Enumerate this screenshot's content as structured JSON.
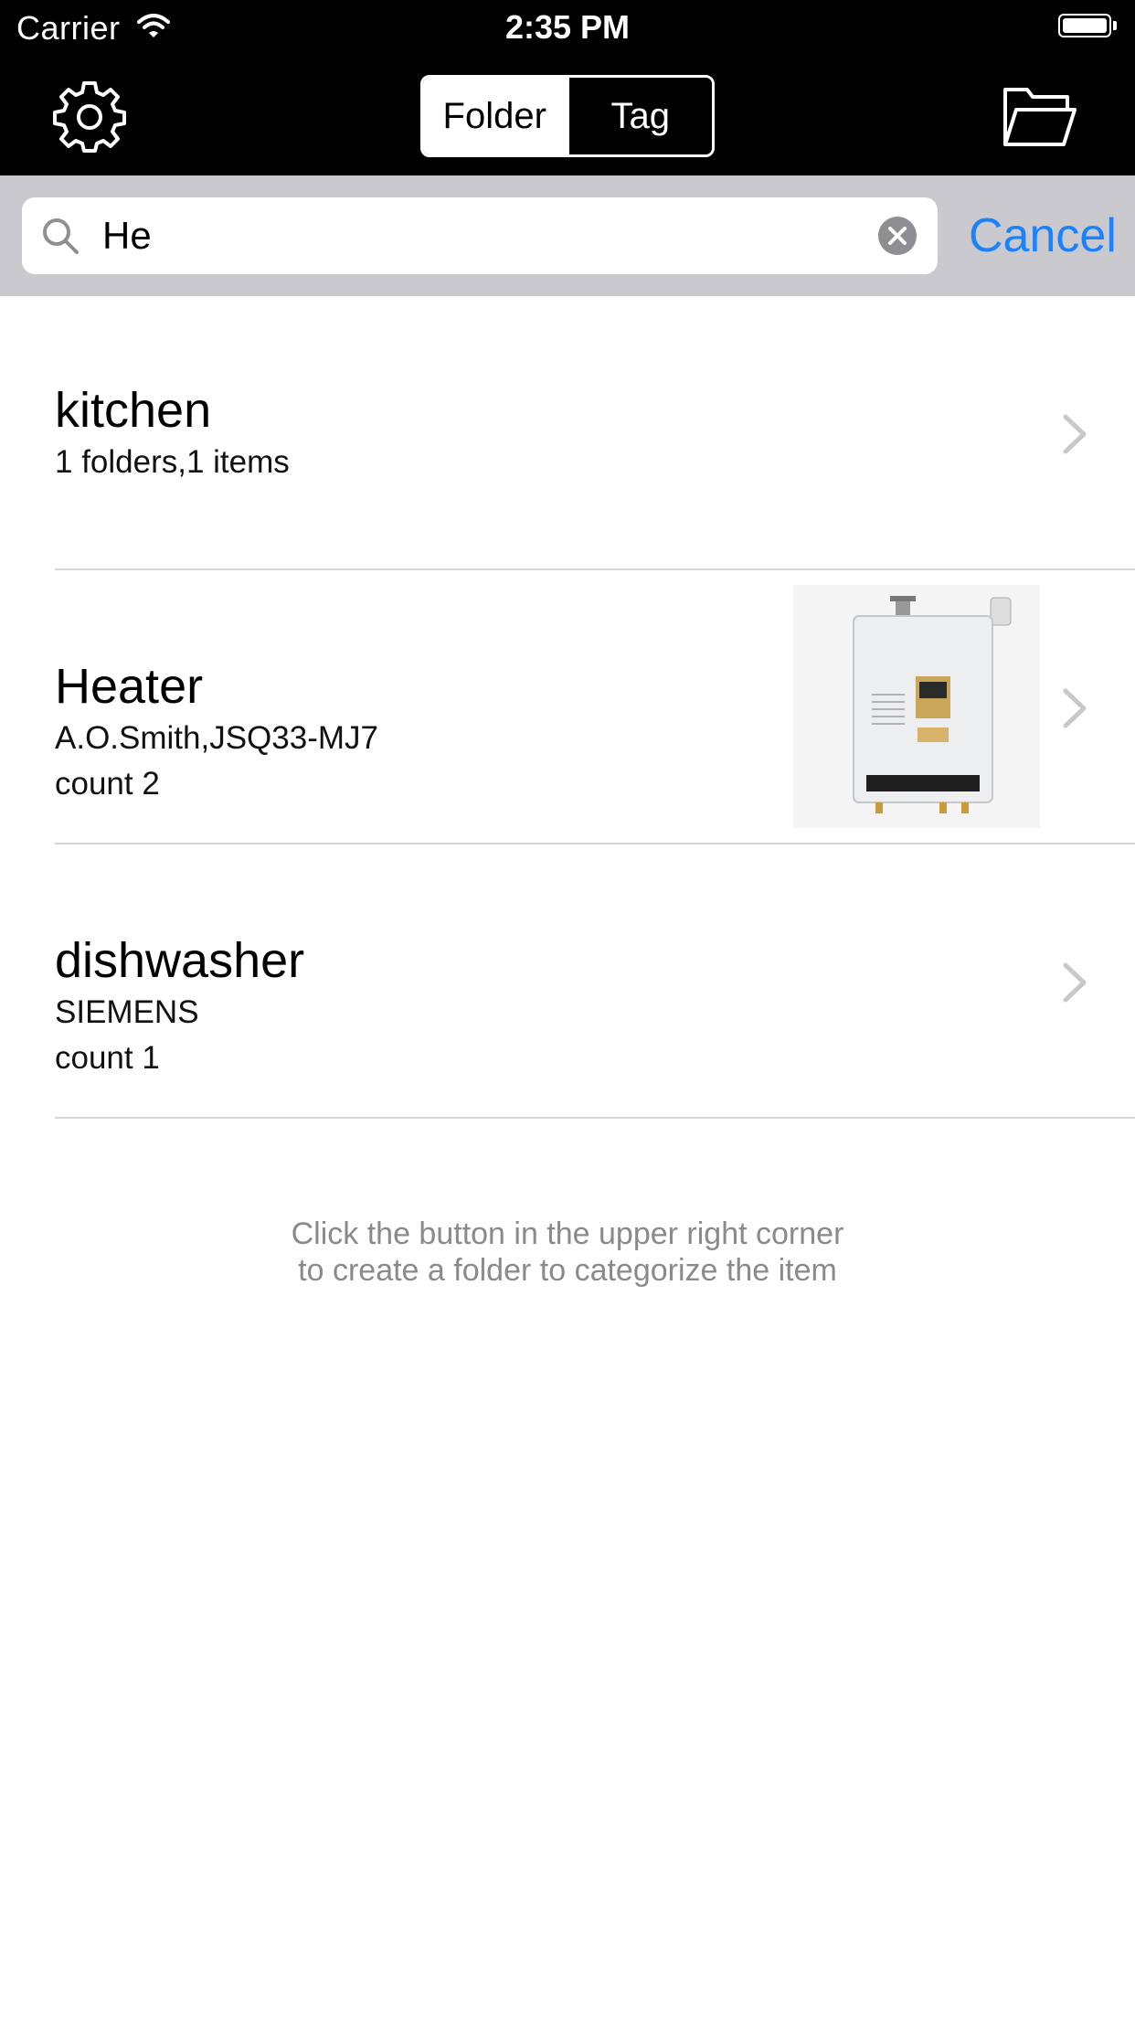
{
  "status_bar": {
    "carrier": "Carrier",
    "time": "2:35 PM"
  },
  "nav": {
    "segments": [
      {
        "label": "Folder",
        "selected": true
      },
      {
        "label": "Tag",
        "selected": false
      }
    ]
  },
  "search": {
    "value": "He",
    "cancel_label": "Cancel"
  },
  "list": {
    "items": [
      {
        "title": "kitchen",
        "line1": "1 folders,1 items"
      },
      {
        "title": "Heater",
        "line1": "A.O.Smith,JSQ33-MJ7",
        "line2": "count 2"
      },
      {
        "title": "dishwasher",
        "line1": "SIEMENS",
        "line2": "count 1"
      }
    ]
  },
  "footer": {
    "line1": "Click the button in the upper right corner",
    "line2": "to create a folder to categorize the item"
  },
  "colors": {
    "accent": "#1a82fb",
    "bar": "#000000",
    "search_bg": "#c9c9ce"
  },
  "icons": [
    "gear-icon",
    "folder-open-icon",
    "search-icon",
    "clear-icon",
    "chevron-right-icon",
    "wifi-icon",
    "battery-icon"
  ]
}
